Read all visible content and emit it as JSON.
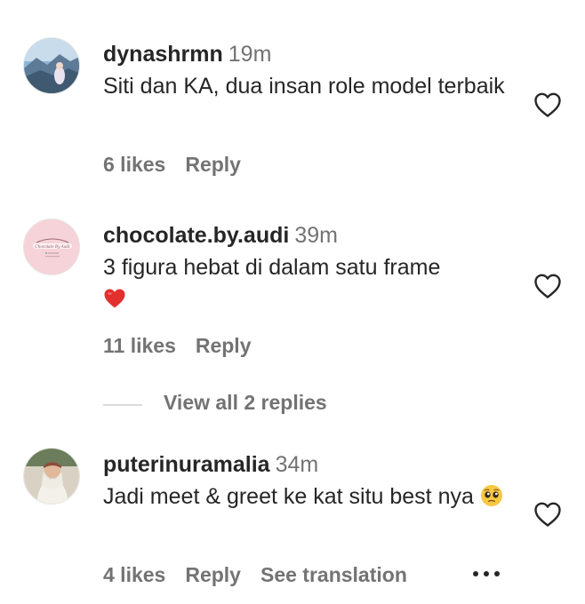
{
  "comments": [
    {
      "username": "dynashrmn",
      "time": "19m",
      "text": "Siti dan KA, dua insan role model terbaik",
      "likes": "6 likes",
      "reply": "Reply"
    },
    {
      "username": "chocolate.by.audi",
      "time": "39m",
      "text": "3 figura hebat di dalam satu frame",
      "emoji": "❤️",
      "likes": "11 likes",
      "reply": "Reply",
      "avatar_text": "Chocolate By Audi"
    },
    {
      "username": "puterinuramalia",
      "time": "34m",
      "text": "Jadi meet & greet ke kat situ best nya",
      "emoji": "🥺",
      "likes": "4 likes",
      "reply": "Reply",
      "see_translation": "See translation"
    }
  ],
  "view_replies": "View all 2 replies",
  "icons": {
    "like": "heart-outline-icon",
    "more": "more-options-icon"
  },
  "colors": {
    "primary_text": "#262626",
    "secondary_text": "#737373",
    "divider": "#dbdbdb"
  }
}
